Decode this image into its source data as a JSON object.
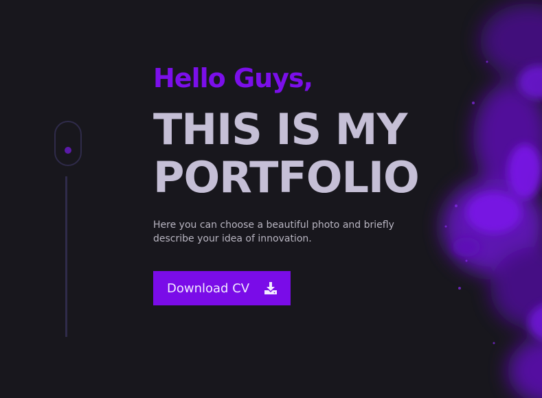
{
  "hero": {
    "greeting": "Hello Guys,",
    "headline_line1": "THIS IS MY",
    "headline_line2": "PORTFOLIO",
    "description": "Here you can choose a beautiful photo and briefly describe your idea of innovation.",
    "download_button": {
      "label": "Download CV",
      "icon": "download-icon"
    }
  },
  "decorations": {
    "scroll_indicator_icon": "mouse-scroll-icon",
    "background_art": "purple-smoke-art"
  },
  "colors": {
    "background": "#18171d",
    "accent": "#7b0fea",
    "headline": "#c5bfd6",
    "body_text": "#b9b6c2"
  }
}
